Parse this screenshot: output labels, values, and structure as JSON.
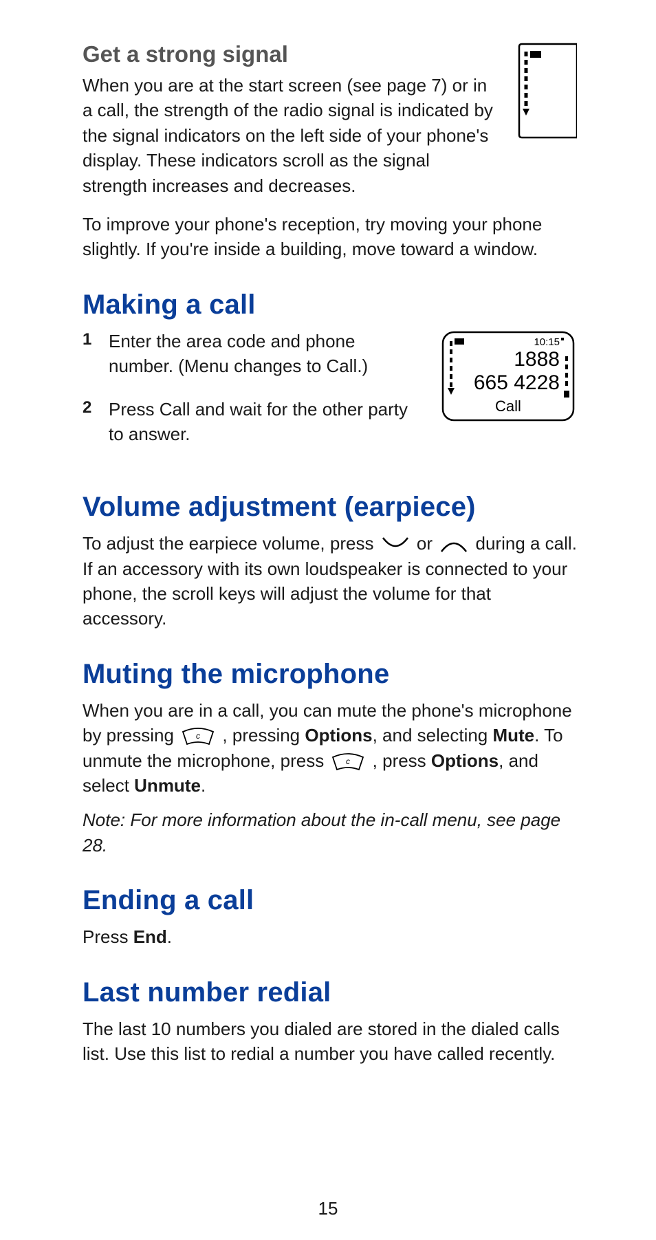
{
  "page_number": "15",
  "s1": {
    "heading": "Get a strong signal",
    "p1": "When you are at the start screen (see page 7) or in a call, the strength of the radio signal is indicated by the signal indicators on the left side of your phone's display. These indicators scroll as the signal strength increases and decreases.",
    "p2": "To improve your phone's reception, try moving your phone slightly. If you're inside a building, move toward a window."
  },
  "s2": {
    "heading": "Making a call",
    "step1_num": "1",
    "step1_a": "Enter the area code and phone number. (",
    "step1_b1": "Menu",
    "step1_c": " changes to ",
    "step1_b2": "Call",
    "step1_d": ".)",
    "step2_num": "2",
    "step2_a": "Press ",
    "step2_b": "Call",
    "step2_c": " and wait for the other party to answer.",
    "screen_time": "10:15",
    "screen_num1": "1888",
    "screen_num2": "665 4228",
    "screen_soft": "Call"
  },
  "s3": {
    "heading": "Volume adjustment (earpiece)",
    "p1a": "To adjust the earpiece volume, press ",
    "p1b": " or ",
    "p1c": " during a call. If an accessory with its own loudspeaker is connected to your phone, the scroll keys will adjust the volume for that accessory."
  },
  "s4": {
    "heading": "Muting the microphone",
    "p1a": "When you are in a call, you can mute the phone's microphone by pressing ",
    "p1b": " , pressing ",
    "p1b1": "Options",
    "p1c": ", and selecting ",
    "p1c1": "Mute",
    "p1d": ". To unmute the microphone, press ",
    "p1e": " , press ",
    "p1e1": "Options",
    "p1f": ", and select ",
    "p1f1": "Unmute",
    "p1g": ".",
    "note": "Note:  For more information about the in-call menu, see page 28."
  },
  "s5": {
    "heading": "Ending a call",
    "p1a": "Press ",
    "p1b": "End",
    "p1c": "."
  },
  "s6": {
    "heading": "Last number redial",
    "p1": "The last 10 numbers you dialed are stored in the dialed calls list. Use this list to redial a number you have called recently."
  }
}
